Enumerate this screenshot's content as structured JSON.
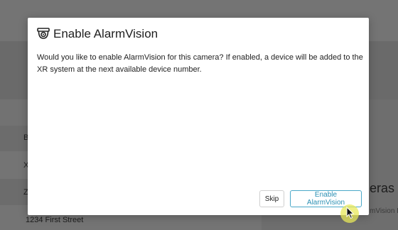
{
  "background": {
    "row_snippets": [
      "B",
      "X",
      "Z"
    ],
    "address": "1234 First Street",
    "right_heading_fragment": "eras",
    "right_sub_fragment": "mVision I"
  },
  "modal": {
    "title": "Enable AlarmVision",
    "title_icon": "security-camera-icon",
    "body": "Would you like to enable AlarmVision for this camera? If enabled, a device will be added to the XR system at the next available device number.",
    "buttons": {
      "skip_label": "Skip",
      "enable_label": "Enable AlarmVision"
    }
  },
  "colors": {
    "accent": "#2a8fb3",
    "accent_border": "#4aa8c8",
    "overlay": "#6f6f6f",
    "cursor_highlight": "#e8e85a"
  }
}
